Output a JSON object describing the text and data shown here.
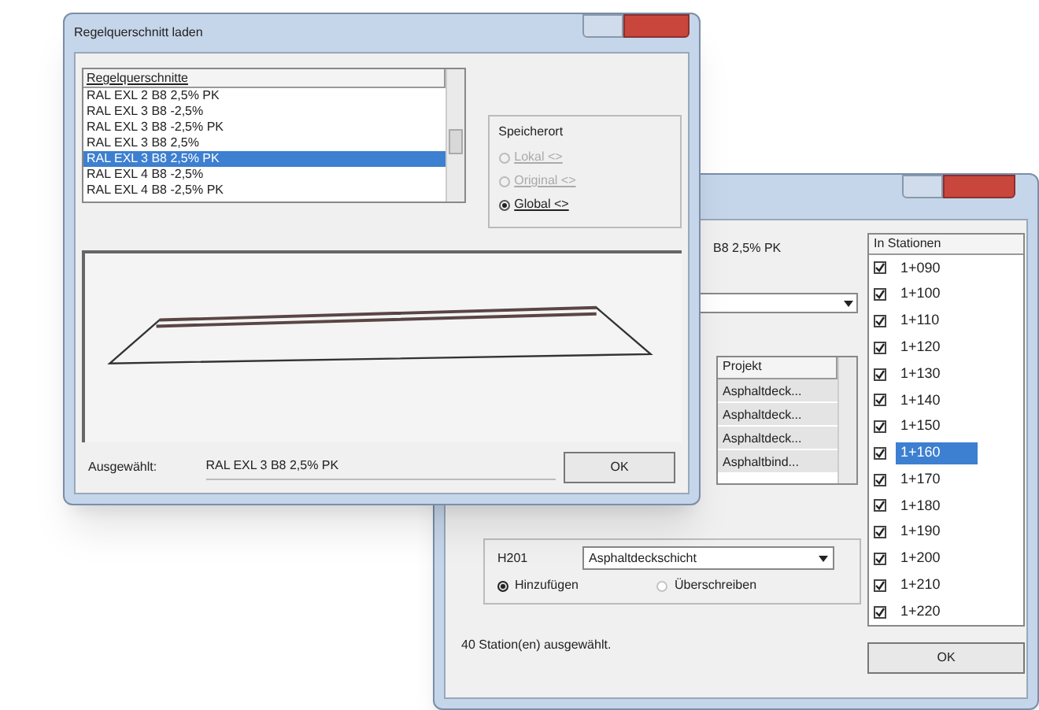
{
  "front_window": {
    "title": "Regelquerschnitt laden",
    "list": {
      "header": "Regelquerschnitte",
      "rows": [
        {
          "label": "RAL EXL 2 B8 2,5% PK",
          "selected": false
        },
        {
          "label": "RAL EXL 3 B8 -2,5%",
          "selected": false
        },
        {
          "label": "RAL EXL 3 B8 -2,5% PK",
          "selected": false
        },
        {
          "label": "RAL EXL 3 B8 2,5%",
          "selected": false
        },
        {
          "label": "RAL EXL 3 B8 2,5% PK",
          "selected": true
        },
        {
          "label": "RAL EXL 4 B8 -2,5%",
          "selected": false
        },
        {
          "label": "RAL EXL 4 B8 -2,5% PK",
          "selected": false
        }
      ]
    },
    "storage": {
      "title": "Speicherort",
      "options": [
        {
          "label": "Lokal <>",
          "selected": false,
          "disabled": true
        },
        {
          "label": "Original <>",
          "selected": false,
          "disabled": true
        },
        {
          "label": "Global <>",
          "selected": true,
          "disabled": false
        }
      ]
    },
    "selected_label": "Ausgewählt:",
    "selected_value": "RAL EXL 3 B8 2,5% PK",
    "ok": "OK"
  },
  "back_window": {
    "summary": "B8 2,5% PK",
    "table": {
      "column": "Projekt",
      "rows": [
        "Asphaltdeck...",
        "Asphaltdeck...",
        "Asphaltdeck...",
        "Asphaltbind..."
      ]
    },
    "layer_code": "H201",
    "layer_select": "Asphaltdeckschicht",
    "modes": [
      {
        "label": "Hinzufügen",
        "selected": true
      },
      {
        "label": "Überschreiben",
        "selected": false
      }
    ],
    "status": "40 Station(en) ausgewählt.",
    "stations": {
      "header": "In Stationen",
      "rows": [
        {
          "label": "1+090",
          "checked": true,
          "selected": false
        },
        {
          "label": "1+100",
          "checked": true,
          "selected": false
        },
        {
          "label": "1+110",
          "checked": true,
          "selected": false
        },
        {
          "label": "1+120",
          "checked": true,
          "selected": false
        },
        {
          "label": "1+130",
          "checked": true,
          "selected": false
        },
        {
          "label": "1+140",
          "checked": true,
          "selected": false
        },
        {
          "label": "1+150",
          "checked": true,
          "selected": false
        },
        {
          "label": "1+160",
          "checked": true,
          "selected": true
        },
        {
          "label": "1+170",
          "checked": true,
          "selected": false
        },
        {
          "label": "1+180",
          "checked": true,
          "selected": false
        },
        {
          "label": "1+190",
          "checked": true,
          "selected": false
        },
        {
          "label": "1+200",
          "checked": true,
          "selected": false
        },
        {
          "label": "1+210",
          "checked": true,
          "selected": false
        },
        {
          "label": "1+220",
          "checked": true,
          "selected": false
        }
      ]
    },
    "ok": "OK"
  }
}
